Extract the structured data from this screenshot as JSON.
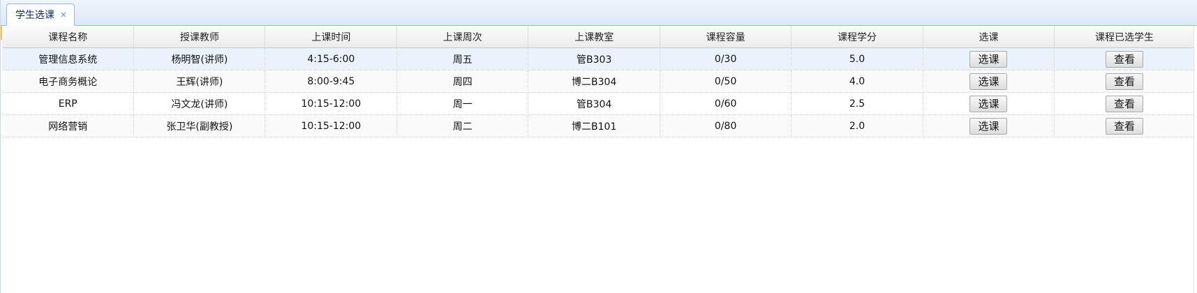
{
  "tabs": [
    {
      "label": "学生选课",
      "close": "×"
    }
  ],
  "table": {
    "columns": [
      "课程名称",
      "授课教师",
      "上课时间",
      "上课周次",
      "上课教室",
      "课程容量",
      "课程学分",
      "选课",
      "课程已选学生"
    ],
    "rows": [
      {
        "course": "管理信息系统",
        "teacher": "杨明智(讲师)",
        "time": "4:15-6:00",
        "weekday": "周五",
        "room": "管B303",
        "capacity": "0/30",
        "credit": "5.0",
        "select": "选课",
        "view": "查看"
      },
      {
        "course": "电子商务概论",
        "teacher": "王辉(讲师)",
        "time": "8:00-9:45",
        "weekday": "周四",
        "room": "博二B304",
        "capacity": "0/50",
        "credit": "4.0",
        "select": "选课",
        "view": "查看"
      },
      {
        "course": "ERP",
        "teacher": "冯文龙(讲师)",
        "time": "10:15-12:00",
        "weekday": "周一",
        "room": "管B304",
        "capacity": "0/60",
        "credit": "2.5",
        "select": "选课",
        "view": "查看"
      },
      {
        "course": "网络营销",
        "teacher": "张卫华(副教授)",
        "time": "10:15-12:00",
        "weekday": "周二",
        "room": "博二B101",
        "capacity": "0/80",
        "credit": "2.0",
        "select": "选课",
        "view": "查看"
      }
    ]
  },
  "colors": {
    "tab_border": "#95b8e7",
    "selected_row": "#eaf2fe",
    "accent": "#f5c842"
  }
}
